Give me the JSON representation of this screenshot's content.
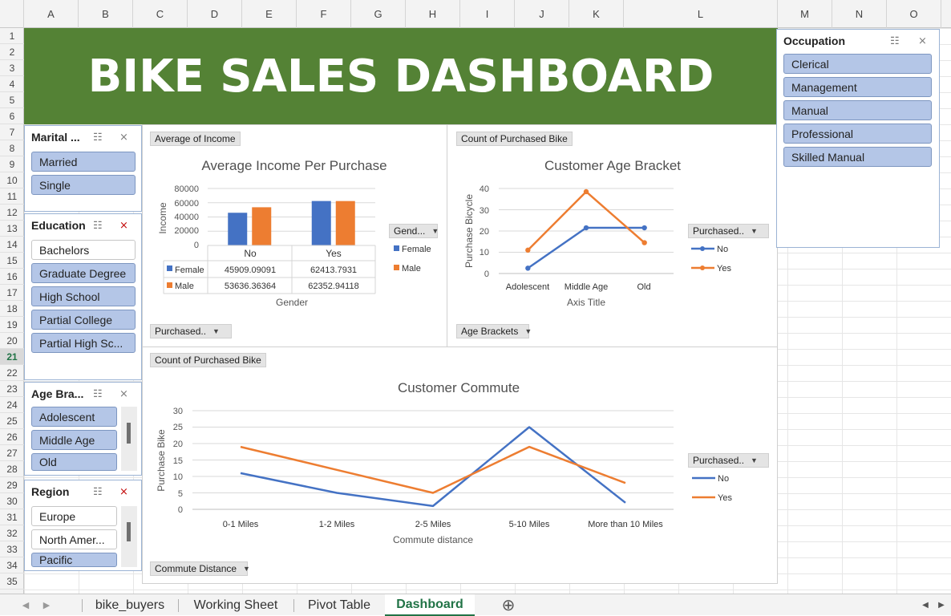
{
  "columns": [
    "A",
    "B",
    "C",
    "D",
    "E",
    "F",
    "G",
    "H",
    "I",
    "J",
    "K",
    "L",
    "M",
    "N",
    "O"
  ],
  "rows": [
    "1",
    "2",
    "3",
    "4",
    "5",
    "6",
    "7",
    "8",
    "9",
    "10",
    "11",
    "12",
    "13",
    "14",
    "15",
    "16",
    "17",
    "18",
    "19",
    "20",
    "21",
    "22",
    "23",
    "24",
    "25",
    "26",
    "27",
    "28",
    "29",
    "30",
    "31",
    "32",
    "33",
    "34",
    "35"
  ],
  "selected_row": "21",
  "banner_title": "BIKE SALES DASHBOARD",
  "colors": {
    "banner": "#548235",
    "series_blue": "#4472c4",
    "series_orange": "#ed7d31",
    "slicer_selected": "#b4c6e7"
  },
  "slicers": {
    "marital": {
      "title": "Marital ...",
      "items": [
        "Married",
        "Single"
      ]
    },
    "education": {
      "title": "Education",
      "items": [
        "Bachelors",
        "Graduate Degree",
        "High School",
        "Partial College",
        "Partial High Sc..."
      ]
    },
    "age": {
      "title": "Age Bra...",
      "items": [
        "Adolescent",
        "Middle Age",
        "Old"
      ]
    },
    "region": {
      "title": "Region",
      "items": [
        "Europe",
        "North Amer...",
        "Pacific"
      ]
    },
    "occupation": {
      "title": "Occupation",
      "items": [
        "Clerical",
        "Management",
        "Manual",
        "Professional",
        "Skilled Manual"
      ]
    }
  },
  "icons": {
    "multiselect": "multi-select-icon",
    "clear_filter": "clear-filter-icon",
    "dropdown": "dropdown-arrow-icon"
  },
  "chart_data": [
    {
      "type": "bar",
      "title": "Average Income Per Purchase",
      "value_field": "Average of Income",
      "row_field": "Purchased..",
      "legend_field": "Gend...",
      "xlabel": "Gender",
      "ylabel": "Income",
      "categories": [
        "No",
        "Yes"
      ],
      "yticks": [
        "80000",
        "60000",
        "40000",
        "20000",
        "0"
      ],
      "ylim": [
        0,
        80000
      ],
      "legend_position": "right",
      "series": [
        {
          "name": "Female",
          "values": [
            45909.09091,
            62413.7931
          ],
          "labels": [
            "45909.09091",
            "62413.7931"
          ]
        },
        {
          "name": "Male",
          "values": [
            53636.36364,
            62352.94118
          ],
          "labels": [
            "53636.36364",
            "62352.94118"
          ]
        }
      ]
    },
    {
      "type": "line",
      "title": "Customer Age Bracket",
      "value_field": "Count of Purchased Bike",
      "axis_field": "Age Brackets",
      "legend_field": "Purchased..",
      "xlabel": "Axis Title",
      "ylabel": "Purchase Bicycle",
      "categories": [
        "Adolescent",
        "Middle Age",
        "Old"
      ],
      "yticks": [
        "40",
        "30",
        "20",
        "10",
        "0"
      ],
      "ylim": [
        0,
        40
      ],
      "legend_position": "right",
      "series": [
        {
          "name": "No",
          "values": [
            2.5,
            21.5,
            21.5
          ]
        },
        {
          "name": "Yes",
          "values": [
            11,
            38.5,
            14.5
          ]
        }
      ]
    },
    {
      "type": "line",
      "title": "Customer Commute",
      "value_field": "Count of Purchased Bike",
      "axis_field": "Commute Distance",
      "legend_field": "Purchased..",
      "xlabel": "Commute distance",
      "ylabel": "Purchase Bike",
      "categories": [
        "0-1 Miles",
        "1-2 Miles",
        "2-5 Miles",
        "5-10 Miles",
        "More than 10 Miles"
      ],
      "yticks": [
        "30",
        "25",
        "20",
        "15",
        "10",
        "5",
        "0"
      ],
      "ylim": [
        0,
        30
      ],
      "legend_position": "right",
      "series": [
        {
          "name": "No",
          "values": [
            11,
            5,
            1,
            25,
            2
          ]
        },
        {
          "name": "Yes",
          "values": [
            19,
            12,
            5,
            19,
            8
          ]
        }
      ]
    }
  ],
  "tabs": [
    "bike_buyers",
    "Working Sheet",
    "Pivot Table",
    "Dashboard"
  ],
  "active_tab": "Dashboard"
}
